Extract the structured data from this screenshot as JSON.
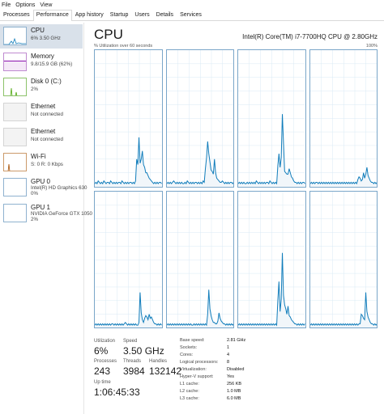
{
  "menu": [
    "File",
    "Options",
    "View"
  ],
  "tabs": [
    "Processes",
    "Performance",
    "App history",
    "Startup",
    "Users",
    "Details",
    "Services"
  ],
  "active_tab": "Performance",
  "sidebar": [
    {
      "title": "CPU",
      "sub1": "6% 3.50 GHz",
      "sub2": "",
      "color": "#117dbb",
      "selected": true
    },
    {
      "title": "Memory",
      "sub1": "9.8/15.9 GB (62%)",
      "sub2": "",
      "color": "#8b12ae",
      "selected": false
    },
    {
      "title": "Disk 0 (C:)",
      "sub1": "2%",
      "sub2": "",
      "color": "#4da60c",
      "selected": false
    },
    {
      "title": "Ethernet",
      "sub1": "Not connected",
      "sub2": "",
      "color": "#a0a0a0",
      "selected": false
    },
    {
      "title": "Ethernet",
      "sub1": "Not connected",
      "sub2": "",
      "color": "#a0a0a0",
      "selected": false
    },
    {
      "title": "Wi-Fi",
      "sub1": "S: 0 R: 0 Kbps",
      "sub2": "",
      "color": "#a74f01",
      "selected": false
    },
    {
      "title": "GPU 0",
      "sub1": "Intel(R) HD Graphics 630",
      "sub2": "0%",
      "color": "#117dbb",
      "selected": false
    },
    {
      "title": "GPU 1",
      "sub1": "NVIDIA GeForce GTX 1050",
      "sub2": "2%",
      "color": "#117dbb",
      "selected": false
    }
  ],
  "main": {
    "title": "CPU",
    "model": "Intel(R) Core(TM) i7-7700HQ CPU @ 2.80GHz",
    "util_label": "% Utilization over 60 seconds",
    "max_label": "100%"
  },
  "stats": {
    "utilization_label": "Utilization",
    "utilization": "6%",
    "speed_label": "Speed",
    "speed": "3.50 GHz",
    "processes_label": "Processes",
    "processes": "243",
    "threads_label": "Threads",
    "threads": "3984",
    "handles_label": "Handles",
    "handles": "132142",
    "uptime_label": "Up time",
    "uptime": "1:06:45:33"
  },
  "specs": [
    {
      "label": "Base speed:",
      "value": "2.81 GHz"
    },
    {
      "label": "Sockets:",
      "value": "1"
    },
    {
      "label": "Cores:",
      "value": "4"
    },
    {
      "label": "Logical processors:",
      "value": "8"
    },
    {
      "label": "Virtualization:",
      "value": "Disabled"
    },
    {
      "label": "Hyper-V support:",
      "value": "Yes"
    },
    {
      "label": "L1 cache:",
      "value": "256 KB"
    },
    {
      "label": "L2 cache:",
      "value": "1.0 MB"
    },
    {
      "label": "L3 cache:",
      "value": "6.0 MB"
    }
  ],
  "colors": {
    "cpu_line": "#117dbb",
    "cpu_fill": "#f1f6fa",
    "grid": "#d9eaf4",
    "selected_bg": "#d9e1ea"
  },
  "cores": [
    [
      2,
      3,
      2,
      4,
      3,
      2,
      3,
      2,
      4,
      3,
      2,
      3,
      3,
      2,
      4,
      3,
      2,
      3,
      2,
      3,
      2,
      3,
      3,
      2,
      4,
      3,
      2,
      3,
      2,
      3,
      2,
      3,
      3,
      2,
      3,
      2,
      4,
      20,
      16,
      36,
      17,
      20,
      26,
      16,
      14,
      10,
      10,
      8,
      6,
      5,
      4,
      3,
      2,
      3,
      2,
      3,
      2,
      3,
      3,
      2
    ],
    [
      2,
      3,
      2,
      3,
      2,
      3,
      4,
      3,
      2,
      3,
      2,
      3,
      2,
      3,
      2,
      2,
      3,
      2,
      4,
      3,
      2,
      3,
      2,
      3,
      2,
      3,
      3,
      2,
      3,
      2,
      3,
      2,
      4,
      3,
      13,
      21,
      33,
      24,
      18,
      12,
      11,
      9,
      20,
      10,
      6,
      5,
      4,
      3,
      3,
      4,
      3,
      2,
      3,
      2,
      3,
      2,
      3,
      3,
      2,
      3
    ],
    [
      2,
      3,
      2,
      3,
      2,
      3,
      2,
      2,
      3,
      2,
      3,
      2,
      3,
      2,
      3,
      2,
      4,
      3,
      2,
      3,
      2,
      3,
      2,
      3,
      2,
      3,
      3,
      2,
      4,
      3,
      2,
      3,
      2,
      3,
      2,
      15,
      24,
      14,
      21,
      53,
      32,
      11,
      10,
      9,
      9,
      13,
      10,
      7,
      6,
      4,
      3,
      3,
      2,
      3,
      2,
      3,
      2,
      3,
      3,
      2
    ],
    [
      2,
      3,
      2,
      3,
      2,
      3,
      3,
      2,
      3,
      2,
      3,
      2,
      3,
      2,
      3,
      2,
      3,
      2,
      3,
      2,
      3,
      2,
      3,
      2,
      3,
      2,
      3,
      2,
      3,
      2,
      3,
      2,
      3,
      2,
      3,
      2,
      3,
      2,
      3,
      2,
      3,
      2,
      5,
      7,
      6,
      4,
      5,
      10,
      6,
      9,
      14,
      8,
      6,
      4,
      3,
      3,
      2,
      3,
      2,
      3
    ],
    [
      2,
      3,
      2,
      3,
      2,
      3,
      2,
      3,
      2,
      3,
      2,
      3,
      2,
      3,
      2,
      3,
      3,
      2,
      3,
      2,
      3,
      2,
      3,
      2,
      3,
      2,
      3,
      4,
      3,
      2,
      3,
      2,
      3,
      2,
      3,
      2,
      3,
      2,
      2,
      4,
      26,
      11,
      6,
      4,
      7,
      9,
      8,
      6,
      10,
      7,
      8,
      6,
      4,
      3,
      3,
      2,
      3,
      2,
      3,
      2
    ],
    [
      2,
      3,
      2,
      3,
      2,
      3,
      2,
      3,
      2,
      3,
      2,
      3,
      2,
      3,
      2,
      3,
      2,
      3,
      2,
      3,
      2,
      3,
      2,
      2,
      3,
      2,
      3,
      2,
      3,
      2,
      3,
      2,
      3,
      2,
      3,
      2,
      10,
      28,
      14,
      9,
      6,
      4,
      4,
      3,
      3,
      5,
      11,
      7,
      5,
      4,
      3,
      3,
      2,
      3,
      2,
      3,
      2,
      3,
      2,
      3
    ],
    [
      2,
      3,
      2,
      3,
      2,
      3,
      2,
      3,
      2,
      3,
      2,
      3,
      2,
      3,
      2,
      3,
      2,
      3,
      2,
      3,
      2,
      3,
      2,
      3,
      2,
      3,
      2,
      3,
      2,
      3,
      2,
      3,
      2,
      3,
      2,
      20,
      34,
      12,
      21,
      55,
      24,
      17,
      14,
      10,
      16,
      9,
      8,
      6,
      5,
      4,
      3,
      3,
      2,
      3,
      2,
      3,
      2,
      3,
      2,
      3
    ],
    [
      2,
      3,
      2,
      3,
      2,
      3,
      2,
      3,
      2,
      3,
      2,
      3,
      2,
      3,
      2,
      3,
      2,
      3,
      2,
      3,
      2,
      3,
      2,
      3,
      2,
      3,
      2,
      3,
      2,
      3,
      2,
      3,
      2,
      3,
      2,
      3,
      2,
      3,
      2,
      3,
      2,
      3,
      2,
      3,
      3,
      10,
      9,
      7,
      6,
      26,
      12,
      8,
      6,
      4,
      3,
      3,
      2,
      3,
      2,
      3
    ]
  ]
}
